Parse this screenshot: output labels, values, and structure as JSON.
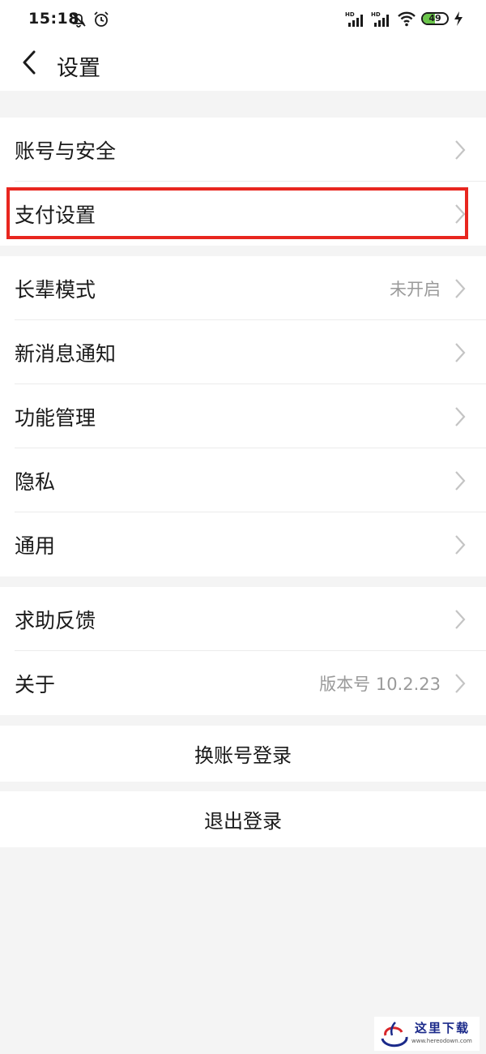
{
  "status_bar": {
    "time": "15:18",
    "icons_left": [
      "mute-bell-icon",
      "alarm-clock-icon"
    ],
    "icons_right": [
      "hd-signal-icon",
      "hd-signal-icon",
      "wifi-icon",
      "battery-icon",
      "charging-icon"
    ],
    "network_tag_1": "HD",
    "network_tag_2": "HD",
    "battery_percent": "49",
    "battery_level": 0.49,
    "battery_color": "#6ac54a"
  },
  "header": {
    "back_icon": "chevron-left-icon",
    "title": "设置"
  },
  "groups": [
    {
      "items": [
        {
          "label": "账号与安全",
          "value": ""
        },
        {
          "label": "支付设置",
          "value": ""
        }
      ]
    },
    {
      "items": [
        {
          "label": "长辈模式",
          "value": "未开启"
        },
        {
          "label": "新消息通知",
          "value": ""
        },
        {
          "label": "功能管理",
          "value": ""
        },
        {
          "label": "隐私",
          "value": ""
        },
        {
          "label": "通用",
          "value": ""
        }
      ]
    },
    {
      "items": [
        {
          "label": "求助反馈",
          "value": ""
        },
        {
          "label": "关于",
          "value": "版本号 10.2.23"
        }
      ]
    }
  ],
  "actions": {
    "switch_account": "换账号登录",
    "logout": "退出登录"
  },
  "highlight_color": "#e8261f",
  "watermark": {
    "text": "这里下载",
    "url": "www.hereodown.com"
  }
}
